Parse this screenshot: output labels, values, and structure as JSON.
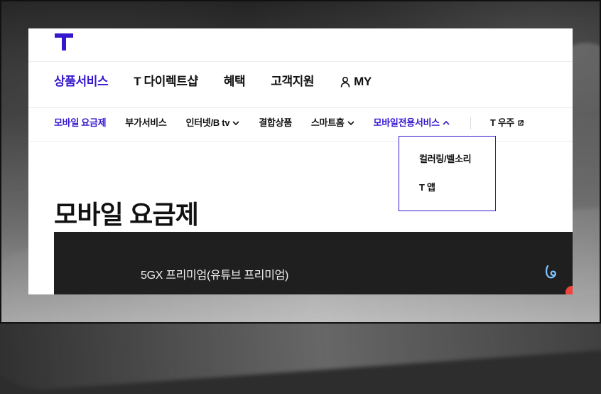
{
  "colors": {
    "brand_purple": "#3617CE",
    "text_dark": "#111111",
    "card_dark": "#1f1f1f",
    "accent_red": "#f0443a",
    "accent_blue": "#7fc3ff"
  },
  "header": {
    "logo_icon": "t-logo-icon"
  },
  "gnb": {
    "items": [
      {
        "label": "상품서비스",
        "active": true
      },
      {
        "label": "T 다이렉트샵"
      },
      {
        "label": "혜택"
      },
      {
        "label": "고객지원"
      },
      {
        "label": "MY",
        "icon": "user-icon"
      }
    ]
  },
  "subnav": {
    "items": [
      {
        "label": "모바일 요금제",
        "active": true
      },
      {
        "label": "부가서비스"
      },
      {
        "label": "인터넷/B tv",
        "icon": "chevron-down-icon"
      },
      {
        "label": "결합상품"
      },
      {
        "label": "스마트홈",
        "icon": "chevron-down-icon"
      },
      {
        "label": "모바일전용서비스",
        "icon": "chevron-up-icon",
        "open": true
      },
      {
        "label": "T 우주",
        "icon": "external-link-icon"
      }
    ]
  },
  "dropdown": {
    "items": [
      {
        "label": "컬러링/벨소리"
      },
      {
        "label": "T 앱"
      }
    ]
  },
  "main": {
    "title": "모바일 요금제",
    "plan_card": {
      "name": "5GX 프리미엄(유튜브 프리미엄)",
      "brand_icon": "brand-mark-icon"
    }
  }
}
